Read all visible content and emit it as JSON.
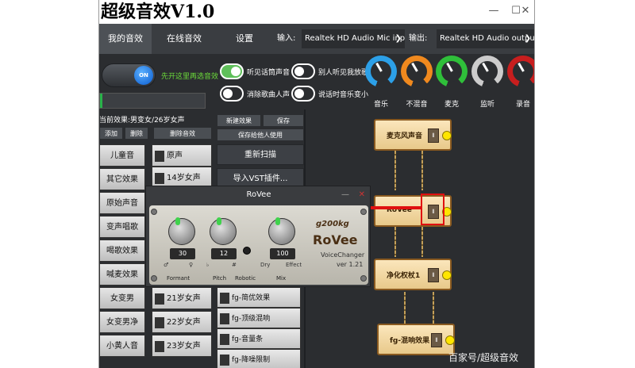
{
  "window": {
    "title": "超级音效V1.0",
    "controls": {
      "minimize": "—",
      "maximize": "☐",
      "close": "✕"
    }
  },
  "tabs": [
    {
      "label": "我的音效",
      "active": true
    },
    {
      "label": "在线音效",
      "active": false
    },
    {
      "label": "设置",
      "active": false
    }
  ],
  "io": {
    "input_label": "输入:",
    "input_value": "Realtek HD Audio Mic input",
    "output_label": "输出:",
    "output_value": "Realtek HD Audio output"
  },
  "main_switch": {
    "label": "ON",
    "hint": "先开这里再选音效"
  },
  "meter": {
    "level": 0.02
  },
  "toggles": [
    {
      "label": "听见话筒声音",
      "state": "on"
    },
    {
      "label": "消除歌曲人声",
      "state": "off"
    },
    {
      "label": "别人听见我放歌",
      "state": "off"
    },
    {
      "label": "说话时音乐变小",
      "state": "off"
    }
  ],
  "knobs": [
    {
      "label": "音乐",
      "color": "#2ca0e8"
    },
    {
      "label": "不混音",
      "color": "#f0891e"
    },
    {
      "label": "麦克",
      "color": "#2fbf3a"
    },
    {
      "label": "监听",
      "color": "#cccccc"
    },
    {
      "label": "录音",
      "color": "#c81e1e"
    }
  ],
  "current_effect": "当前效果:男变女/26岁女声",
  "small_buttons": {
    "add": "添加",
    "delete": "删除",
    "delete_effect": "删除音效",
    "new_effect": "新建效果",
    "save": "保存",
    "save_others": "保存给他人使用"
  },
  "categories": [
    "儿童音",
    "其它效果",
    "原始声音",
    "变声唱歌",
    "喝歌效果",
    "喊麦效果",
    "女变男",
    "女变男净",
    "小黄人音"
  ],
  "presets": [
    "原声",
    "14岁女声",
    "21岁女声",
    "22岁女声",
    "23岁女声"
  ],
  "actions": {
    "rescan": "重新扫描",
    "import_vst": "导入VST插件..."
  },
  "fg_items": [
    "fg-简优效果",
    "fg-顶级混响",
    "fg-音量条",
    "fg-降噪限制"
  ],
  "chain": [
    {
      "name": "麦克风声音"
    },
    {
      "name": "RoVee"
    },
    {
      "name": "净化权杖1"
    },
    {
      "name": "fg-混响效果"
    }
  ],
  "rovee": {
    "window_title": "RoVee",
    "minimize": "—",
    "close": "✕",
    "brand": "g200kg",
    "product": "RoVee",
    "subtitle": "VoiceChanger",
    "version": "ver 1.21",
    "knobs": [
      {
        "value": "30"
      },
      {
        "value": "12"
      },
      {
        "value": "100"
      }
    ],
    "labels": {
      "formant": "Formant",
      "pitch": "Pitch",
      "robotic": "Robotic",
      "mix": "Mix",
      "dry": "Dry",
      "effect": "Effect"
    },
    "symbols": {
      "male": "♂",
      "female": "♀",
      "flat": "♭",
      "sharp": "#"
    }
  },
  "watermark": "百家号/超级音效"
}
